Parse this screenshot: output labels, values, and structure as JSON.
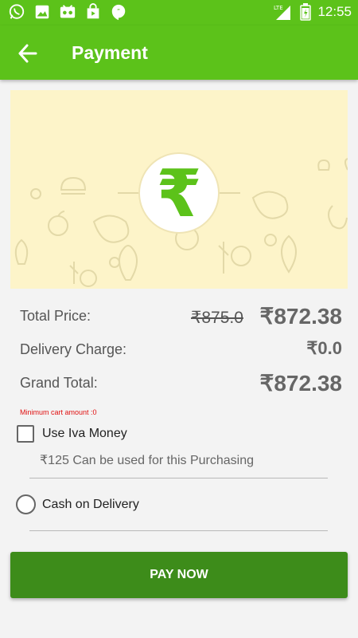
{
  "status_bar": {
    "time": "12:55",
    "network": "LTE",
    "left_icons": [
      "whatsapp-icon",
      "image-icon",
      "voicemail-icon",
      "store-icon",
      "hangouts-icon"
    ],
    "right_icons": [
      "signal-icon",
      "battery-icon"
    ]
  },
  "toolbar": {
    "title": "Payment",
    "back_icon": "arrow-left-icon"
  },
  "banner": {
    "symbol": "₹",
    "accent": "#5cc21a",
    "background": "#fdf4c9"
  },
  "summary": {
    "total_price_label": "Total Price:",
    "total_price_original": "₹875.0",
    "total_price_value": "₹872.38",
    "delivery_label": "Delivery Charge:",
    "delivery_value": "₹0.0",
    "grand_total_label": "Grand Total:",
    "grand_total_value": "₹872.38"
  },
  "wallet": {
    "min_note": "Minimum cart amount :0",
    "label": "Use Iva Money",
    "checked": false,
    "sub": "₹125 Can be used for this Purchasing"
  },
  "cod": {
    "label": "Cash on Delivery",
    "selected": false
  },
  "pay_button": {
    "label": "PAY NOW",
    "color": "#3d8c1a"
  }
}
